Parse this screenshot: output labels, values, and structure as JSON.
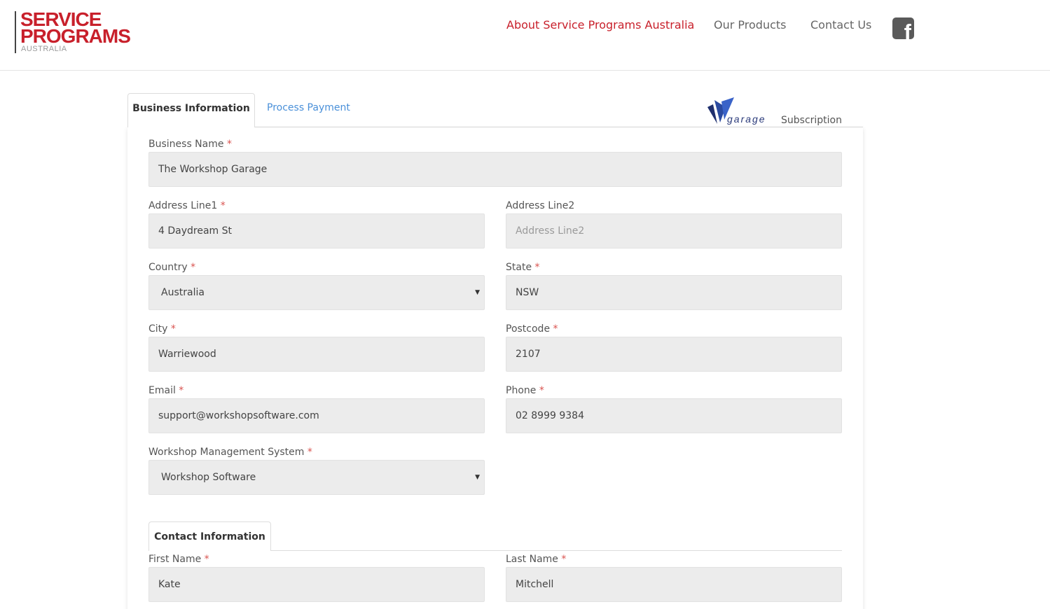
{
  "header": {
    "logo": {
      "line1": "SERVICE",
      "line2": "PROGRAMS",
      "line3": "AUSTRALIA"
    },
    "nav": [
      {
        "label": "About Service Programs Australia",
        "active": true
      },
      {
        "label": "Our Products",
        "active": false
      },
      {
        "label": "Contact Us",
        "active": false
      }
    ],
    "facebook_icon": "facebook-icon"
  },
  "tabs": {
    "business_information": "Business Information",
    "process_payment": "Process Payment"
  },
  "brand": {
    "garage_logo_text": "garage",
    "subscription": "Subscription"
  },
  "form": {
    "required_mark": "*",
    "business_name": {
      "label": "Business Name",
      "value": "The Workshop Garage"
    },
    "address_line1": {
      "label": "Address Line1",
      "value": "4 Daydream St"
    },
    "address_line2": {
      "label": "Address Line2",
      "placeholder": "Address Line2"
    },
    "country": {
      "label": "Country",
      "value": "Australia"
    },
    "state": {
      "label": "State",
      "value": "NSW"
    },
    "city": {
      "label": "City",
      "value": "Warriewood"
    },
    "postcode": {
      "label": "Postcode",
      "value": "2107"
    },
    "email": {
      "label": "Email",
      "value": "support@workshopsoftware.com"
    },
    "phone": {
      "label": "Phone",
      "value": "02 8999 9384"
    },
    "wms": {
      "label": "Workshop Management System",
      "value": "Workshop Software"
    }
  },
  "contact": {
    "tab": "Contact Information",
    "first_name": {
      "label": "First Name",
      "value": "Kate"
    },
    "last_name": {
      "label": "Last Name",
      "value": "Mitchell"
    }
  },
  "colors": {
    "brand_red": "#c8202b",
    "link_blue": "#4a90d9",
    "required_red": "#d9534f",
    "field_bg": "#ececec"
  }
}
